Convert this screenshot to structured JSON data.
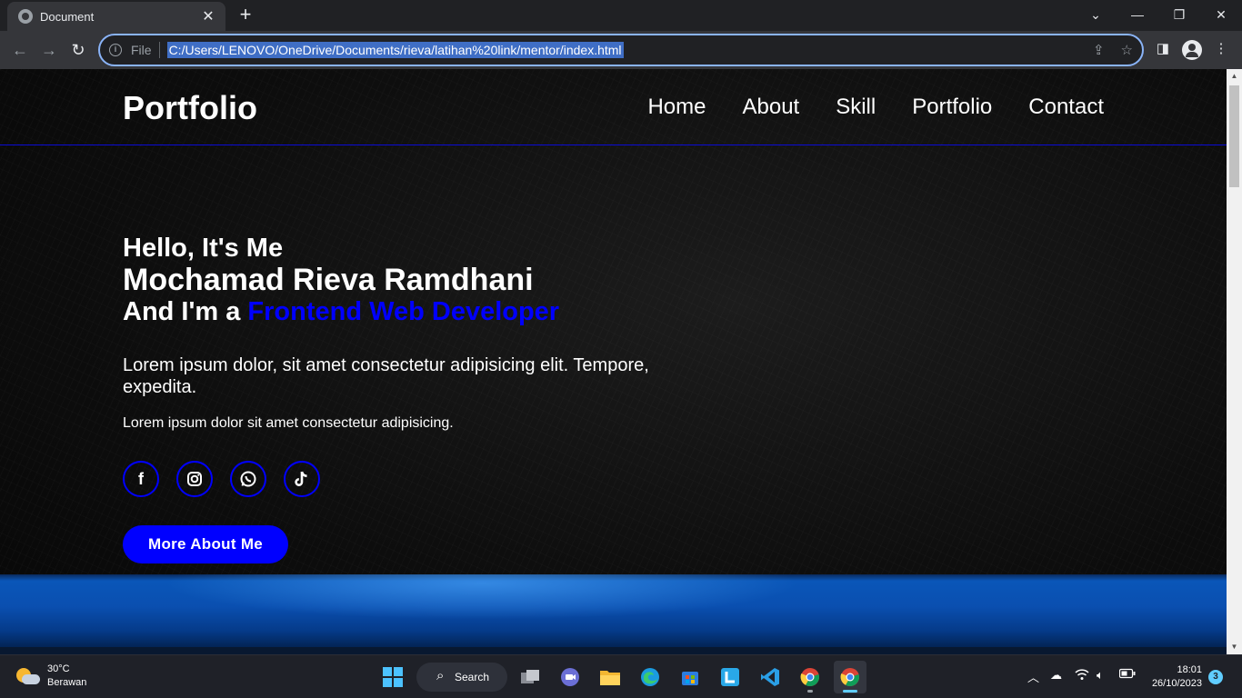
{
  "browser": {
    "tab_title": "Document",
    "tab_close": "✕",
    "new_tab": "+",
    "omnibox": {
      "scheme_label": "File",
      "url": "C:/Users/LENOVO/OneDrive/Documents/rieva/latihan%20link/mentor/index.html"
    }
  },
  "site": {
    "logo": "Portfolio",
    "nav": [
      "Home",
      "About",
      "Skill",
      "Portfolio",
      "Contact"
    ],
    "hero": {
      "greeting": "Hello, It's Me",
      "name": "Mochamad Rieva Ramdhani",
      "role_prefix": "And I'm a ",
      "role": "Frontend Web Developer",
      "desc1": "Lorem ipsum dolor, sit amet consectetur adipisicing elit. Tempore, expedita.",
      "desc2": "Lorem ipsum dolor sit amet consectetur adipisicing.",
      "socials": [
        "facebook-icon",
        "instagram-icon",
        "whatsapp-icon",
        "tiktok-icon"
      ],
      "cta": "More About Me"
    },
    "colors": {
      "accent": "#0000ff"
    }
  },
  "taskbar": {
    "weather": {
      "temp": "30°C",
      "condition": "Berawan"
    },
    "search_label": "Search",
    "time": "18:01",
    "date": "26/10/2023",
    "notifications": "3"
  }
}
